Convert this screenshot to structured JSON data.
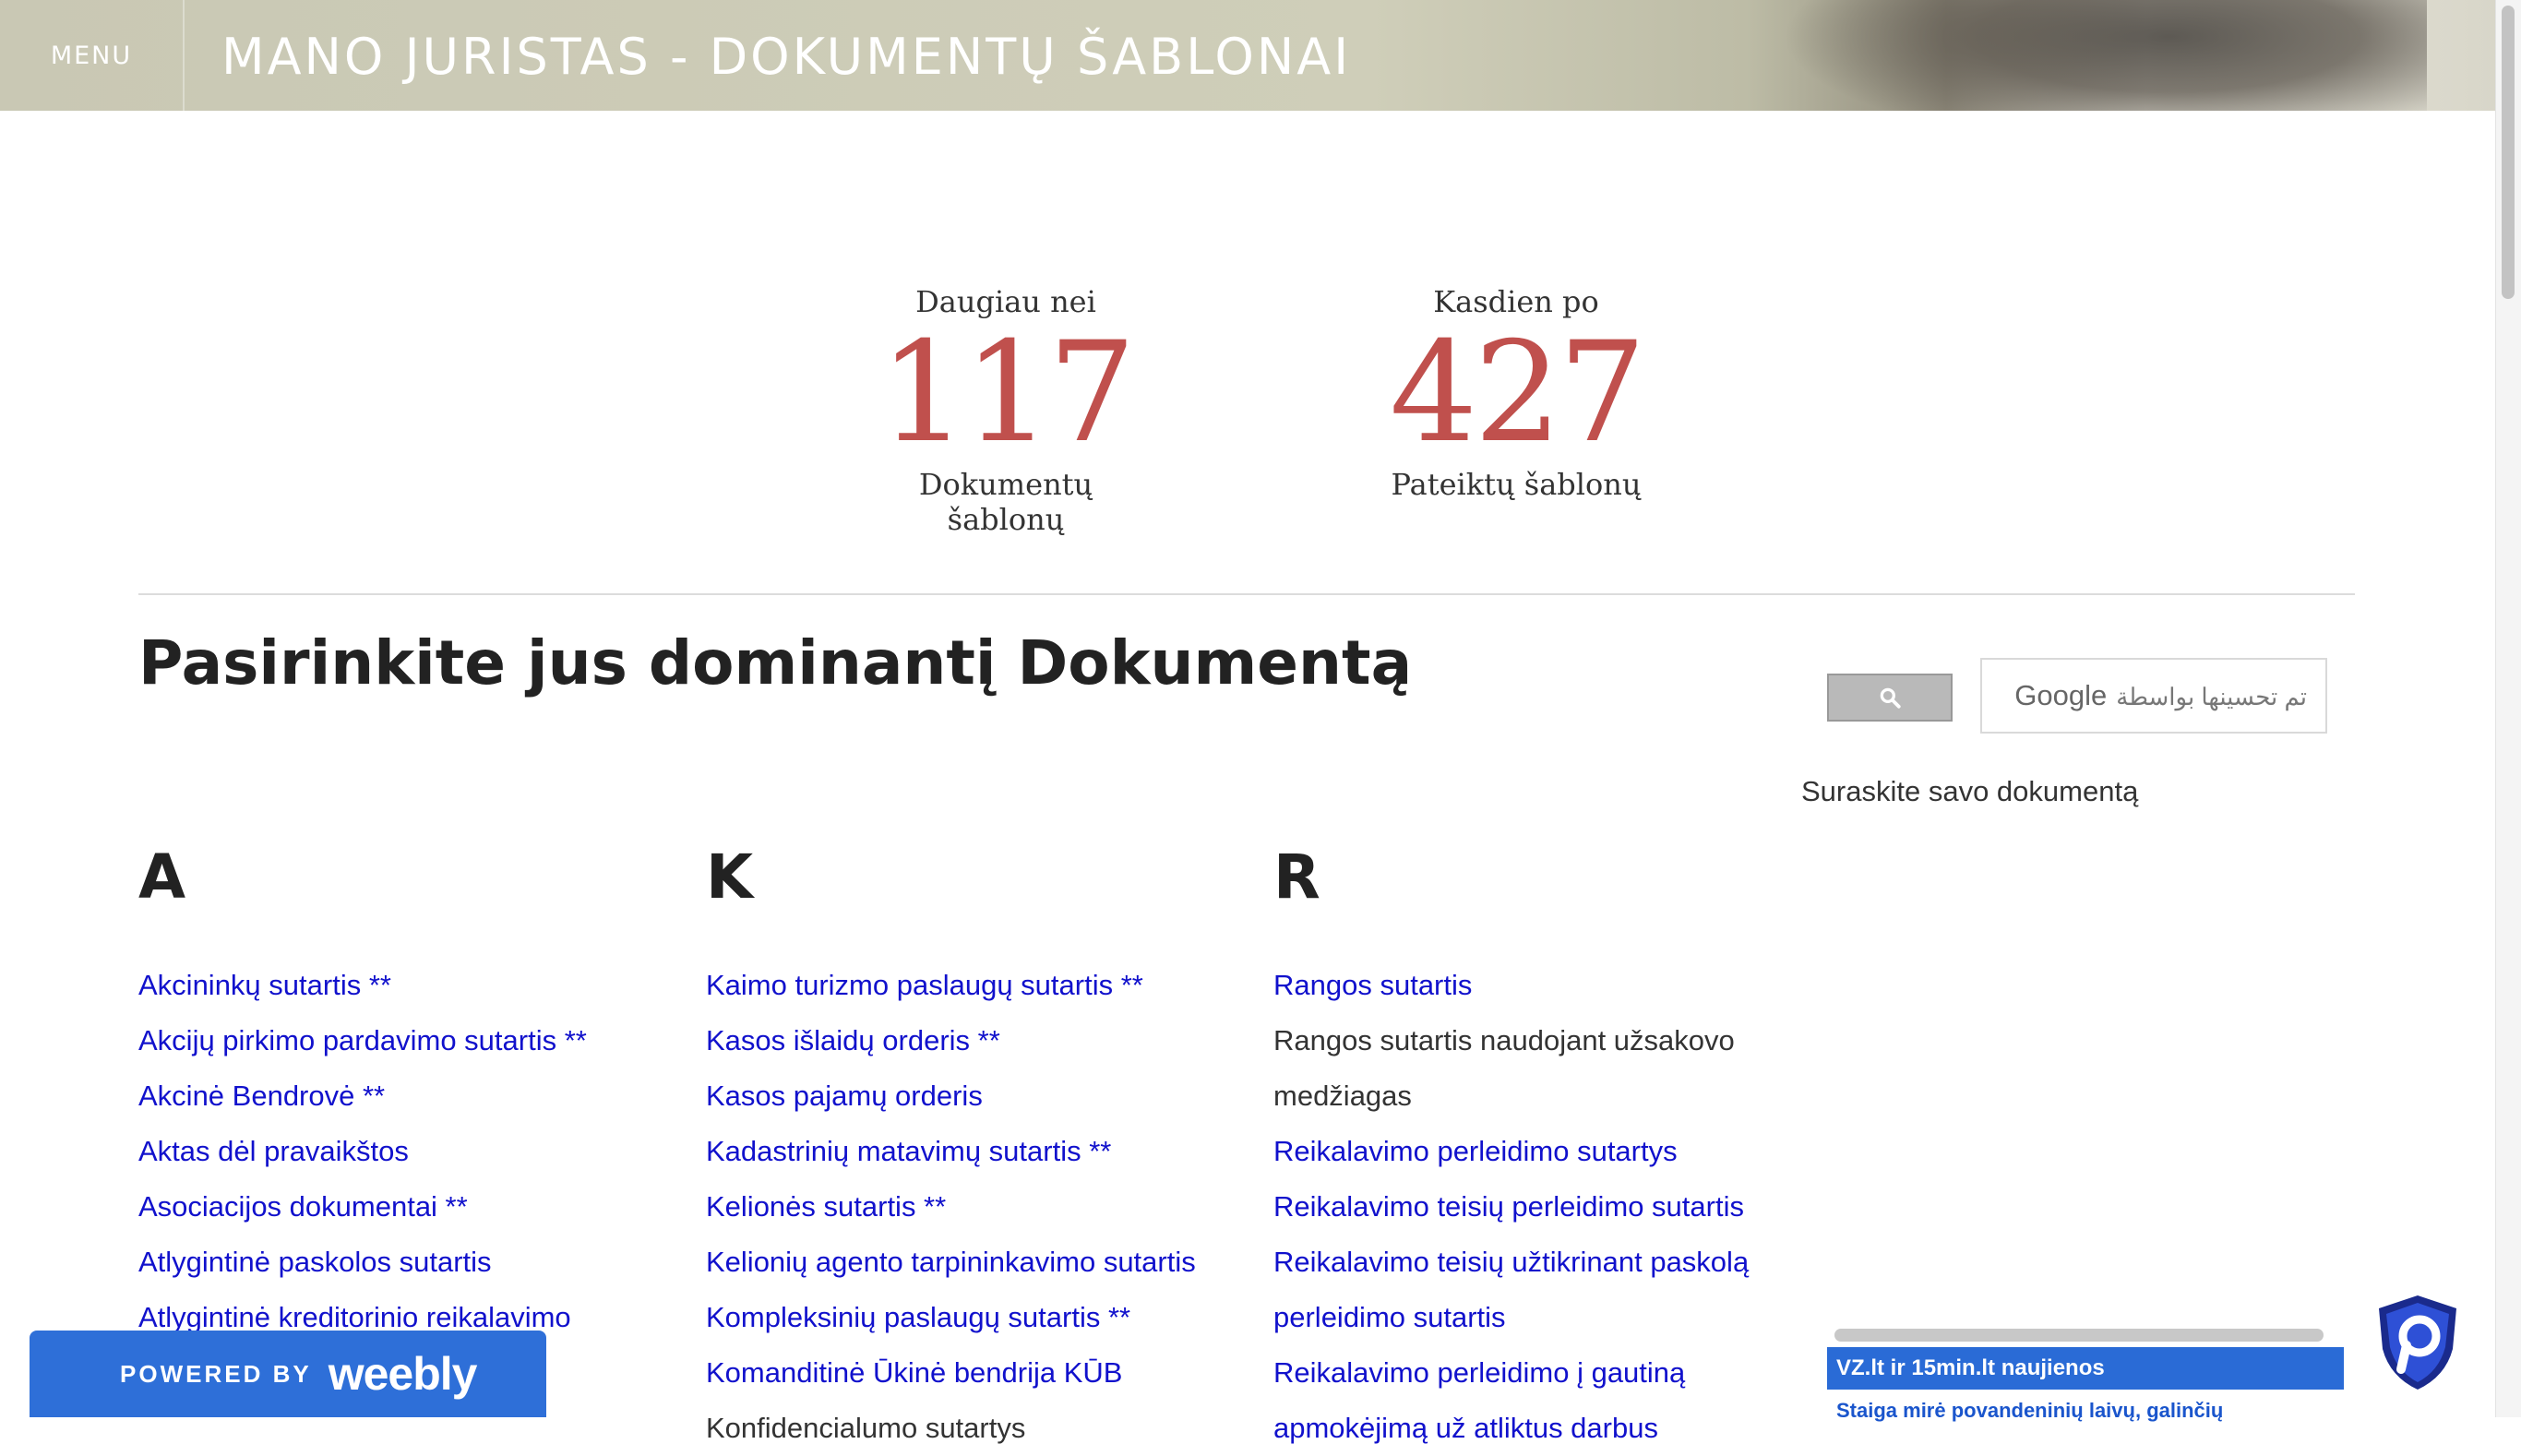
{
  "header": {
    "menu_label": "MENU",
    "site_title": "MANO JURISTAS - DOKUMENTŲ ŠABLONAI"
  },
  "stats": [
    {
      "top": "Daugiau nei",
      "number": "117",
      "bottom": "Dokumentų šablonų"
    },
    {
      "top": "Kasdien po",
      "number": "427",
      "bottom": "Pateiktų šablonų"
    }
  ],
  "main": {
    "heading": "Pasirinkite jus dominantį Dokumentą"
  },
  "columns": [
    {
      "letter": "A",
      "items": [
        {
          "label": "Akcininkų sutartis **"
        },
        {
          "label": "Akcijų pirkimo pardavimo sutartis **"
        },
        {
          "label": "Akcinė Bendrovė **"
        },
        {
          "label": "Aktas dėl pravaikštos"
        },
        {
          "label": "Asociacijos dokumentai **"
        },
        {
          "label": "Atlygintinė paskolos sutartis"
        },
        {
          "label": "Atlygintinė kreditorinio reikalavimo"
        }
      ]
    },
    {
      "letter": "K",
      "items": [
        {
          "label": "Kaimo turizmo paslaugų sutartis **"
        },
        {
          "label": "Kasos išlaidų orderis **"
        },
        {
          "label": "Kasos pajamų orderis"
        },
        {
          "label": "Kadastrinių matavimų sutartis **"
        },
        {
          "label": "Kelionės sutartis **"
        },
        {
          "label": "Kelionių agento tarpininkavimo sutartis"
        },
        {
          "label": "Kompleksinių paslaugų sutartis **"
        },
        {
          "label": "Komanditinė Ūkinė bendrija KŪB"
        },
        {
          "label": "Konfidencialumo sutartys"
        }
      ]
    },
    {
      "letter": "R",
      "items": [
        {
          "label": "Rangos sutartis"
        },
        {
          "label": "Rangos sutartis naudojant užsakovo"
        },
        {
          "label": "medžiagas"
        },
        {
          "label": "Reikalavimo perleidimo sutartys"
        },
        {
          "label": "Reikalavimo teisių perleidimo sutartis"
        },
        {
          "label": "Reikalavimo teisių užtikrinant paskolą"
        },
        {
          "label": "perleidimo sutartis"
        },
        {
          "label": "Reikalavimo perleidimo į gautiną"
        },
        {
          "label": "apmokėjimą už atliktus darbus"
        }
      ]
    }
  ],
  "search": {
    "google_label": "Google",
    "placeholder_text": "تم تحسينها بواسطة",
    "caption": "Suraskite savo dokumentą"
  },
  "news_widget": {
    "title": "VZ.lt ir 15min.lt naujienos",
    "first_item": "Staiga mirė povandeninių laivų, galinčių"
  },
  "footer_badge": {
    "powered_by": "POWERED BY",
    "brand": "weebly"
  },
  "colors": {
    "link": "#1111cc",
    "stat_number": "#c0504d",
    "weebly_blue": "#2e6fd8"
  }
}
